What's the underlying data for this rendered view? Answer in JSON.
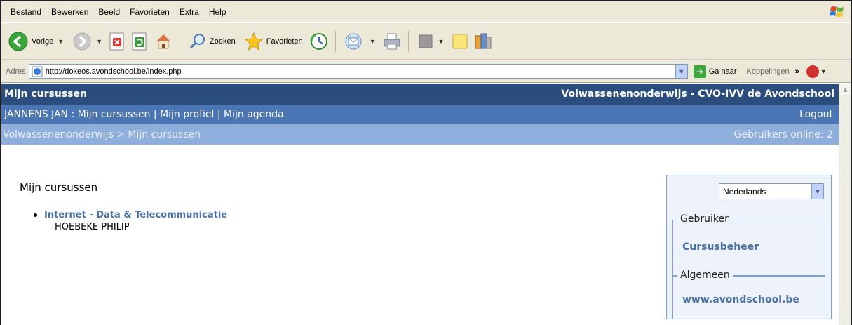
{
  "browser": {
    "menu": [
      "Bestand",
      "Bewerken",
      "Beeld",
      "Favorieten",
      "Extra",
      "Help"
    ],
    "toolbar": {
      "back_label": "Vorige",
      "search_label": "Zoeken",
      "favorites_label": "Favorieten"
    },
    "address": {
      "label": "Adres",
      "url": "http://dokeos.avondschool.be/index.php",
      "go_label": "Ga naar",
      "links_label": "Koppelingen"
    }
  },
  "header": {
    "title": "Mijn cursussen",
    "institution": "Volwassenenonderwijs - CVO-IVV de Avondschool"
  },
  "nav": {
    "user_prefix": "JANNENS JAN :",
    "my_courses": "Mijn cursussen",
    "sep": "|",
    "my_profile": "Mijn profiel",
    "my_agenda": "Mijn agenda",
    "logout": "Logout"
  },
  "breadcrumb": {
    "path": "Volwassenenonderwijs > Mijn cursussen",
    "online": "Gebruikers online: 2"
  },
  "main": {
    "title": "Mijn cursussen",
    "courses": [
      {
        "title": "Internet - Data & Telecommunicatie",
        "teacher": "HOEBEKE PHILIP"
      }
    ]
  },
  "sidebar": {
    "language": "Nederlands",
    "user_section": {
      "legend": "Gebruiker",
      "link": "Cursusbeheer"
    },
    "general_section": {
      "legend": "Algemeen",
      "link": "www.avondschool.be"
    }
  }
}
